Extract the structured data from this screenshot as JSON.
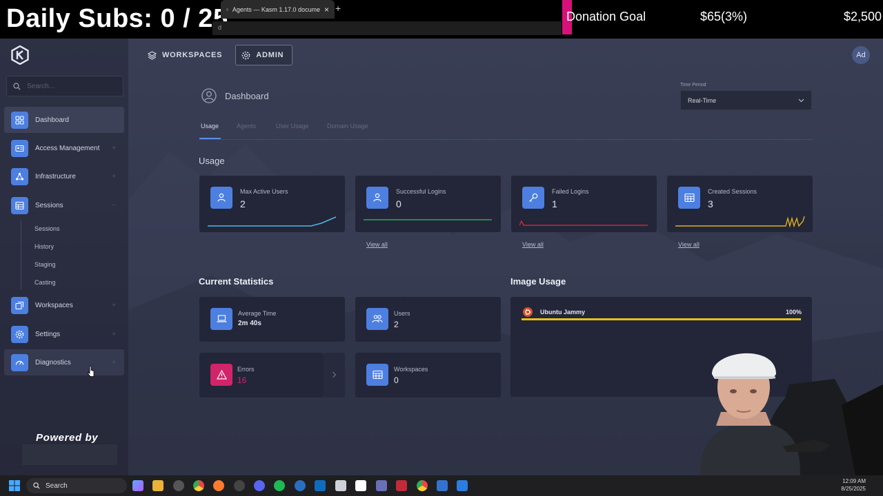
{
  "overlay": {
    "daily_subs": "Daily Subs: 0 / 25",
    "donation_label": "Donation Goal",
    "donation_current": "$65(3%)",
    "donation_target": "$2,500"
  },
  "browser": {
    "tab_title": "Agents — Kasm 1.17.0 docume",
    "tab_close": "×",
    "new_tab": "+",
    "address_text": "d"
  },
  "header": {
    "nav": [
      {
        "label": "WORKSPACES",
        "active": false
      },
      {
        "label": "ADMIN",
        "active": true
      }
    ],
    "avatar_initials": "Ad"
  },
  "sidebar": {
    "search_placeholder": "Search...",
    "items": [
      {
        "label": "Dashboard",
        "icon": "dashboard-icon",
        "active": true,
        "expander": ""
      },
      {
        "label": "Access Management",
        "icon": "id-card-icon",
        "active": false,
        "expander": "+"
      },
      {
        "label": "Infrastructure",
        "icon": "network-icon",
        "active": false,
        "expander": "+"
      },
      {
        "label": "Sessions",
        "icon": "table-icon",
        "active": false,
        "expander": "−"
      },
      {
        "label": "Workspaces",
        "icon": "workspaces-icon",
        "active": false,
        "expander": "+"
      },
      {
        "label": "Settings",
        "icon": "gear-icon",
        "active": false,
        "expander": "+"
      },
      {
        "label": "Diagnostics",
        "icon": "gauge-icon",
        "active": false,
        "expander": "+"
      }
    ],
    "session_subitems": [
      "Sessions",
      "History",
      "Staging",
      "Casting"
    ],
    "powered_by": "Powered by"
  },
  "main": {
    "page_title": "Dashboard",
    "time_period_label": "Time Period",
    "time_period_value": "Real-Time",
    "tabs": [
      "Usage",
      "Agents",
      "User Usage",
      "Domain Usage"
    ],
    "usage_title": "Usage",
    "usage_cards": [
      {
        "label": "Max Active Users",
        "value": "2",
        "icon": "users-icon",
        "spark_color": "#4fb7e8",
        "view_all": ""
      },
      {
        "label": "Successful Logins",
        "value": "0",
        "icon": "users-icon",
        "spark_color": "#2fbf5f",
        "view_all": "View all"
      },
      {
        "label": "Failed Logins",
        "value": "1",
        "icon": "key-icon",
        "spark_color": "#c8263c",
        "view_all": "View all"
      },
      {
        "label": "Created Sessions",
        "value": "3",
        "icon": "table-icon",
        "spark_color": "#e0b11c",
        "view_all": "View all"
      }
    ],
    "current_stats_title": "Current Statistics",
    "stats": [
      {
        "label": "Average Time",
        "value": "2m 40s",
        "icon": "laptop-icon"
      },
      {
        "label": "Users",
        "value": "2",
        "icon": "users-icon"
      },
      {
        "label": "Errors",
        "value": "16",
        "icon": "warning-icon"
      },
      {
        "label": "Workspaces",
        "value": "0",
        "icon": "table-icon"
      }
    ],
    "image_usage_title": "Image Usage",
    "images": [
      {
        "name": "Ubuntu Jammy",
        "percent": "100%",
        "bar_fraction": 1.0
      }
    ]
  },
  "taskbar": {
    "search_label": "Search",
    "time": "12:09 AM",
    "date": "8/25/2025"
  },
  "colors": {
    "accent": "#4d7fe0",
    "error": "#d1246a",
    "image_bar": "#e7c016"
  }
}
